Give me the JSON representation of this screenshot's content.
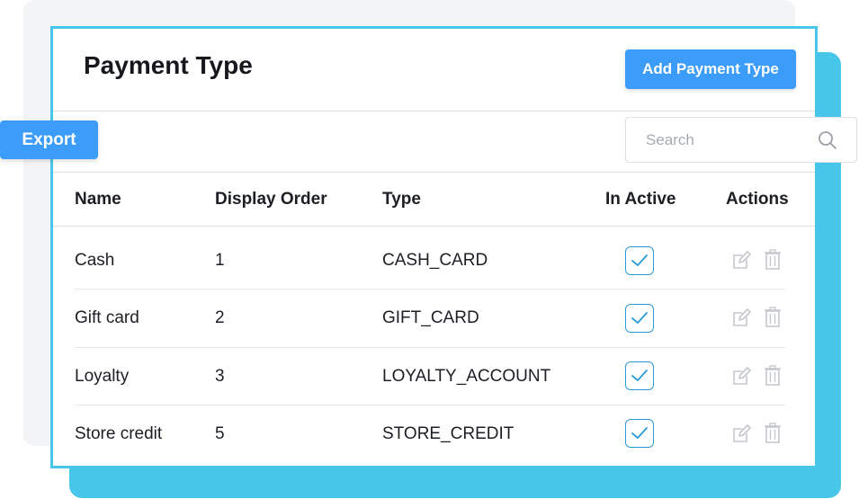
{
  "page": {
    "title": "Payment Type",
    "add_button": "Add Payment Type",
    "export_button": "Export"
  },
  "search": {
    "placeholder": "Search"
  },
  "table": {
    "headers": {
      "name": "Name",
      "display_order": "Display Order",
      "type": "Type",
      "in_active": "In Active",
      "actions": "Actions"
    },
    "rows": [
      {
        "name": "Cash",
        "display_order": "1",
        "type": "CASH_CARD",
        "in_active": true
      },
      {
        "name": "Gift card",
        "display_order": "2",
        "type": "GIFT_CARD",
        "in_active": true
      },
      {
        "name": "Loyalty",
        "display_order": "3",
        "type": "LOYALTY_ACCOUNT",
        "in_active": true
      },
      {
        "name": "Store credit",
        "display_order": "5",
        "type": "STORE_CREDIT",
        "in_active": true
      }
    ]
  },
  "icons": {
    "search": "search-icon",
    "check": "check-icon",
    "edit": "edit-icon",
    "delete": "trash-icon"
  },
  "colors": {
    "accent": "#3b9cf9",
    "frame": "#48c6ea",
    "checkbox": "#2b9bd8",
    "action_icon": "#c4c8cd"
  }
}
